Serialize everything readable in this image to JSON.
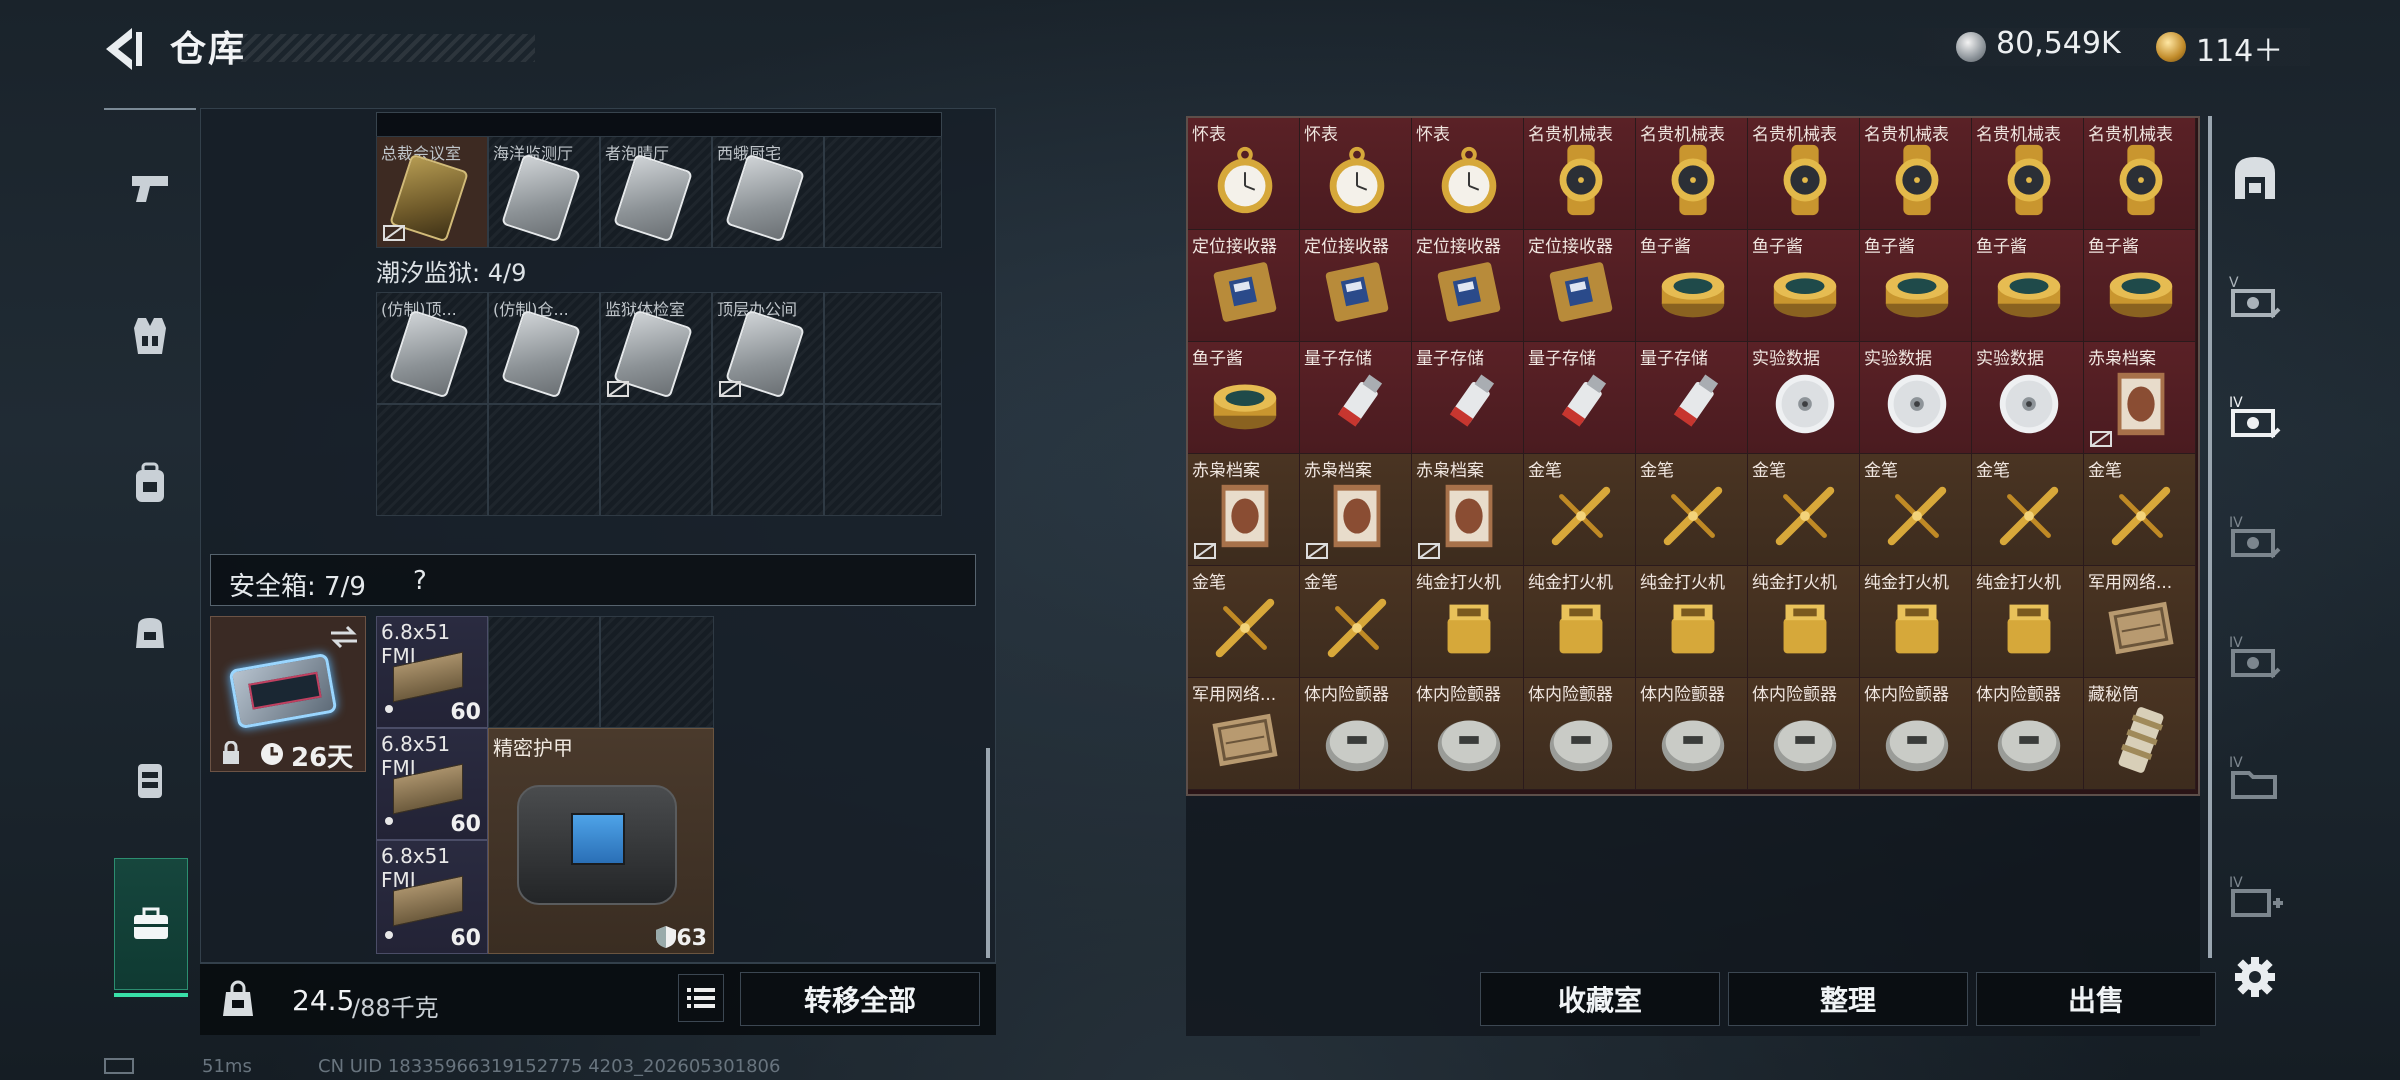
{
  "header": {
    "title": "仓库",
    "currency_silver": "80,549K",
    "currency_gold": "114＋"
  },
  "left_panel": {
    "top_row_labels": [
      "总裁会议室",
      "海洋监测厅",
      "者泡晴厅",
      "西蛾厨宅"
    ],
    "section_title": "潮汐监狱: 4/9",
    "prison_row_labels": [
      "(仿制)顶...",
      "(仿制)仓...",
      "监狱体检室",
      "顶层办公间"
    ],
    "safe_box_title": "安全箱: 7/9",
    "safe_box_help": "?",
    "safe_box_days": "26天",
    "ammo_items": [
      {
        "label": "6.8x51\nFMJ",
        "qty": "60"
      },
      {
        "label": "6.8x51\nFMJ",
        "qty": "60"
      },
      {
        "label": "6.8x51\nFMJ",
        "qty": "60"
      }
    ],
    "armor_name": "精密护甲",
    "armor_value": "63",
    "weight_current": "24.5",
    "weight_max": "/88千克",
    "transfer_all": "转移全部"
  },
  "right_grid": {
    "rows": [
      [
        {
          "name": "怀表",
          "icon": "pocket-watch",
          "bg": "red"
        },
        {
          "name": "怀表",
          "icon": "pocket-watch",
          "bg": "red"
        },
        {
          "name": "怀表",
          "icon": "pocket-watch",
          "bg": "red"
        },
        {
          "name": "名贵机械表",
          "icon": "gold-wristwatch",
          "bg": "red"
        },
        {
          "name": "名贵机械表",
          "icon": "gold-wristwatch",
          "bg": "red"
        },
        {
          "name": "名贵机械表",
          "icon": "gold-wristwatch",
          "bg": "red"
        },
        {
          "name": "名贵机械表",
          "icon": "gold-wristwatch",
          "bg": "red"
        },
        {
          "name": "名贵机械表",
          "icon": "gold-wristwatch",
          "bg": "red"
        },
        {
          "name": "名贵机械表",
          "icon": "gold-wristwatch",
          "bg": "red"
        }
      ],
      [
        {
          "name": "定位接收器",
          "icon": "locator-receiver",
          "bg": "red"
        },
        {
          "name": "定位接收器",
          "icon": "locator-receiver",
          "bg": "red"
        },
        {
          "name": "定位接收器",
          "icon": "locator-receiver",
          "bg": "red"
        },
        {
          "name": "定位接收器",
          "icon": "locator-receiver",
          "bg": "red"
        },
        {
          "name": "鱼子酱",
          "icon": "caviar-tin",
          "bg": "red"
        },
        {
          "name": "鱼子酱",
          "icon": "caviar-tin",
          "bg": "red"
        },
        {
          "name": "鱼子酱",
          "icon": "caviar-tin",
          "bg": "red"
        },
        {
          "name": "鱼子酱",
          "icon": "caviar-tin",
          "bg": "red"
        },
        {
          "name": "鱼子酱",
          "icon": "caviar-tin",
          "bg": "red"
        }
      ],
      [
        {
          "name": "鱼子酱",
          "icon": "caviar-tin",
          "bg": "red"
        },
        {
          "name": "量子存储",
          "icon": "usb-drive",
          "bg": "red"
        },
        {
          "name": "量子存储",
          "icon": "usb-drive",
          "bg": "red"
        },
        {
          "name": "量子存储",
          "icon": "usb-drive",
          "bg": "red"
        },
        {
          "name": "量子存储",
          "icon": "usb-drive",
          "bg": "red"
        },
        {
          "name": "实验数据",
          "icon": "data-disc",
          "bg": "red"
        },
        {
          "name": "实验数据",
          "icon": "data-disc",
          "bg": "red"
        },
        {
          "name": "实验数据",
          "icon": "data-disc",
          "bg": "red"
        },
        {
          "name": "赤枭档案",
          "icon": "dossier",
          "bg": "red",
          "broken": true
        }
      ],
      [
        {
          "name": "赤枭档案",
          "icon": "dossier",
          "bg": "gold",
          "broken": true
        },
        {
          "name": "赤枭档案",
          "icon": "dossier",
          "bg": "gold",
          "broken": true
        },
        {
          "name": "赤枭档案",
          "icon": "dossier",
          "bg": "gold",
          "broken": true
        },
        {
          "name": "金笔",
          "icon": "gold-pen",
          "bg": "gold"
        },
        {
          "name": "金笔",
          "icon": "gold-pen",
          "bg": "gold"
        },
        {
          "name": "金笔",
          "icon": "gold-pen",
          "bg": "gold"
        },
        {
          "name": "金笔",
          "icon": "gold-pen",
          "bg": "gold"
        },
        {
          "name": "金笔",
          "icon": "gold-pen",
          "bg": "gold"
        },
        {
          "name": "金笔",
          "icon": "gold-pen",
          "bg": "gold"
        }
      ],
      [
        {
          "name": "金笔",
          "icon": "gold-pen",
          "bg": "gold"
        },
        {
          "name": "金笔",
          "icon": "gold-pen",
          "bg": "gold"
        },
        {
          "name": "纯金打火机",
          "icon": "gold-lighter",
          "bg": "gold"
        },
        {
          "name": "纯金打火机",
          "icon": "gold-lighter",
          "bg": "gold"
        },
        {
          "name": "纯金打火机",
          "icon": "gold-lighter",
          "bg": "gold"
        },
        {
          "name": "纯金打火机",
          "icon": "gold-lighter",
          "bg": "gold"
        },
        {
          "name": "纯金打火机",
          "icon": "gold-lighter",
          "bg": "gold"
        },
        {
          "name": "纯金打火机",
          "icon": "gold-lighter",
          "bg": "gold"
        },
        {
          "name": "军用网络...",
          "icon": "network-module",
          "bg": "gold"
        }
      ],
      [
        {
          "name": "军用网络...",
          "icon": "network-module",
          "bg": "gold"
        },
        {
          "name": "体内险颤器",
          "icon": "implant-device",
          "bg": "gold"
        },
        {
          "name": "体内险颤器",
          "icon": "implant-device",
          "bg": "gold"
        },
        {
          "name": "体内险颤器",
          "icon": "implant-device",
          "bg": "gold"
        },
        {
          "name": "体内险颤器",
          "icon": "implant-device",
          "bg": "gold"
        },
        {
          "name": "体内险颤器",
          "icon": "implant-device",
          "bg": "gold"
        },
        {
          "name": "体内险颤器",
          "icon": "implant-device",
          "bg": "gold"
        },
        {
          "name": "体内险颤器",
          "icon": "implant-device",
          "bg": "gold"
        },
        {
          "name": "藏秘筒",
          "icon": "cryptex",
          "bg": "gold"
        }
      ]
    ]
  },
  "right_buttons": {
    "collection": "收藏室",
    "organize": "整理",
    "sell": "出售"
  },
  "right_rail_tabs": [
    "V",
    "IV",
    "IV",
    "IV",
    "IV",
    "IV"
  ],
  "footer": {
    "ping": "51ms",
    "uid": "CN UID 18335966319152775 4203_202605301806"
  }
}
